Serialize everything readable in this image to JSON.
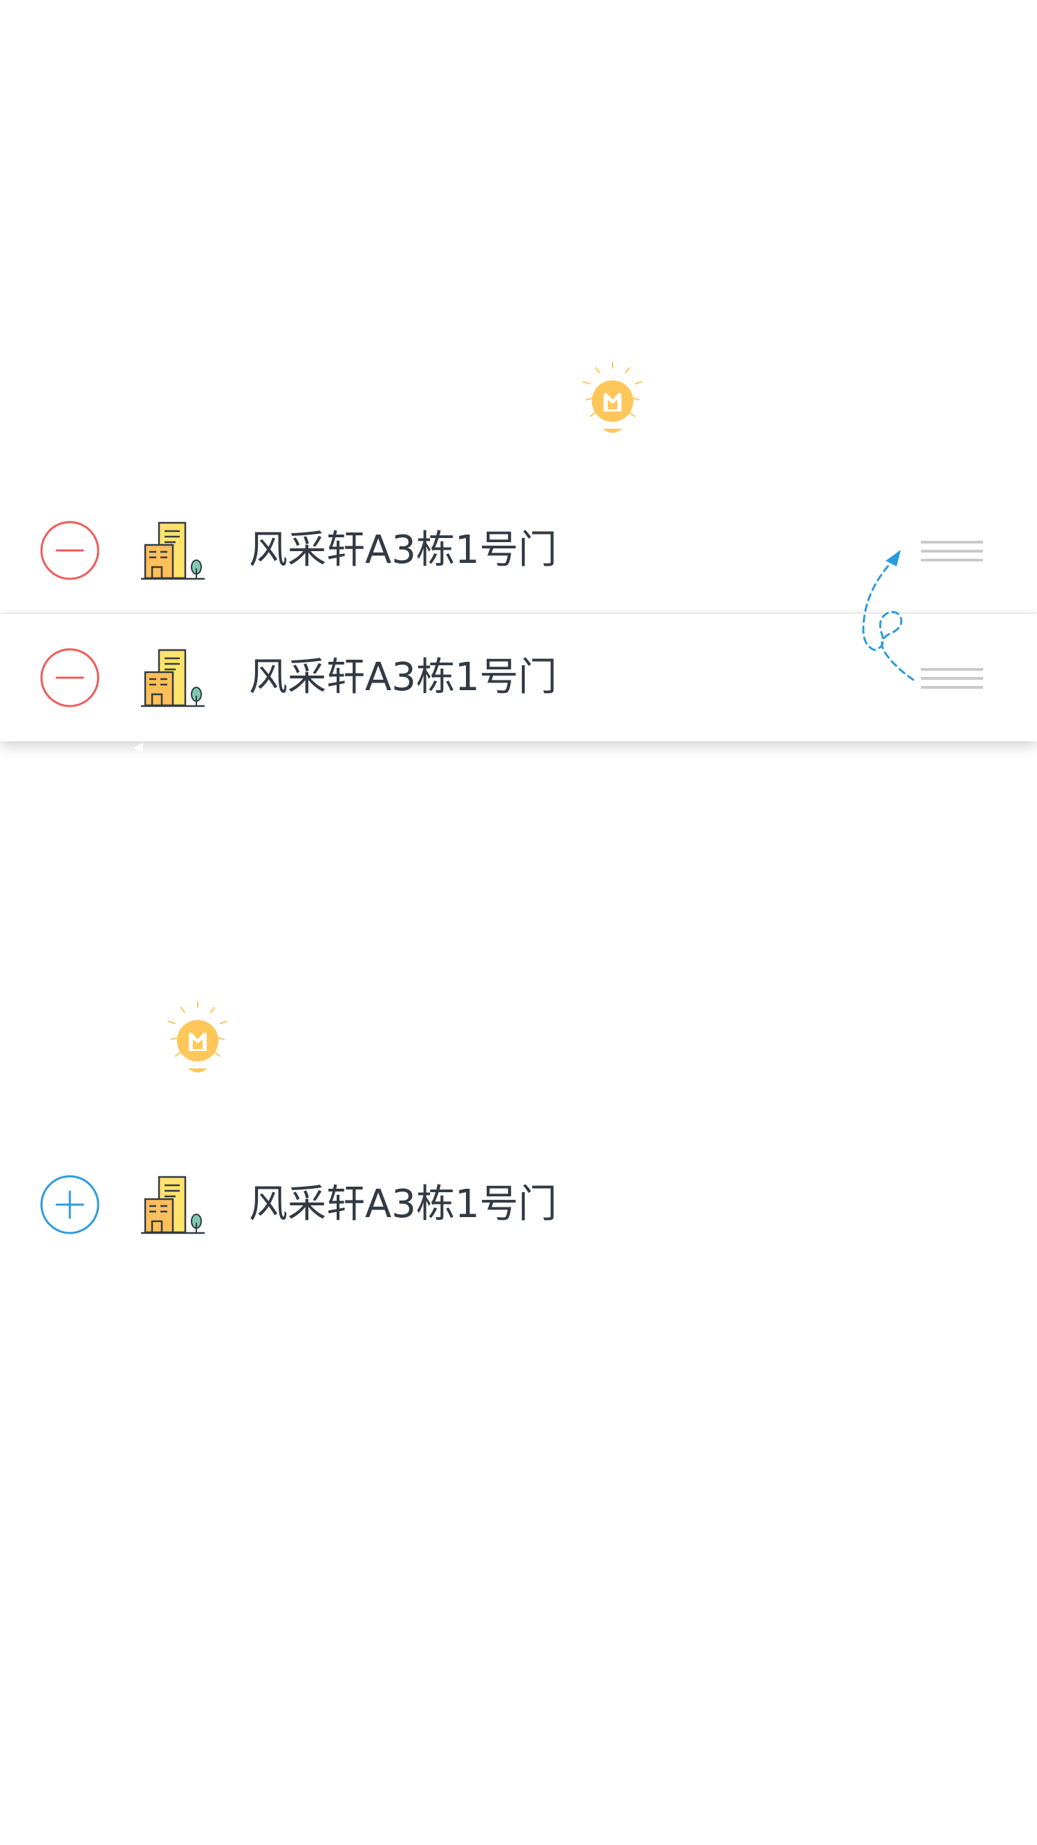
{
  "rows": {
    "edit_row_static": {
      "label": "风采轩A3栋1号门",
      "action": "remove",
      "action_icon": "minus-circle-icon",
      "icon": "building-icon",
      "handle_icon": "drag-handle-icon"
    },
    "edit_row_dragging": {
      "label": "风采轩A3栋1号门",
      "action": "remove",
      "action_icon": "minus-circle-icon",
      "icon": "building-icon",
      "handle_icon": "drag-handle-icon"
    },
    "add_row": {
      "label": "风采轩A3栋1号门",
      "action": "add",
      "action_icon": "plus-circle-icon",
      "icon": "building-icon"
    }
  },
  "hints": {
    "tip_icon_1": "lightbulb-icon",
    "tip_icon_2": "lightbulb-icon",
    "reorder_gesture": "swap-arrow-icon"
  },
  "colors": {
    "remove_red": "#f05a5a",
    "add_blue": "#2a9be0",
    "text": "#333a44",
    "handle_gray": "#c9c9cc",
    "bulb_yellow": "#ffc65a",
    "building_yellow": "#ffe36a",
    "building_orange": "#ffbf5a",
    "tree_green": "#7fc8b2"
  }
}
